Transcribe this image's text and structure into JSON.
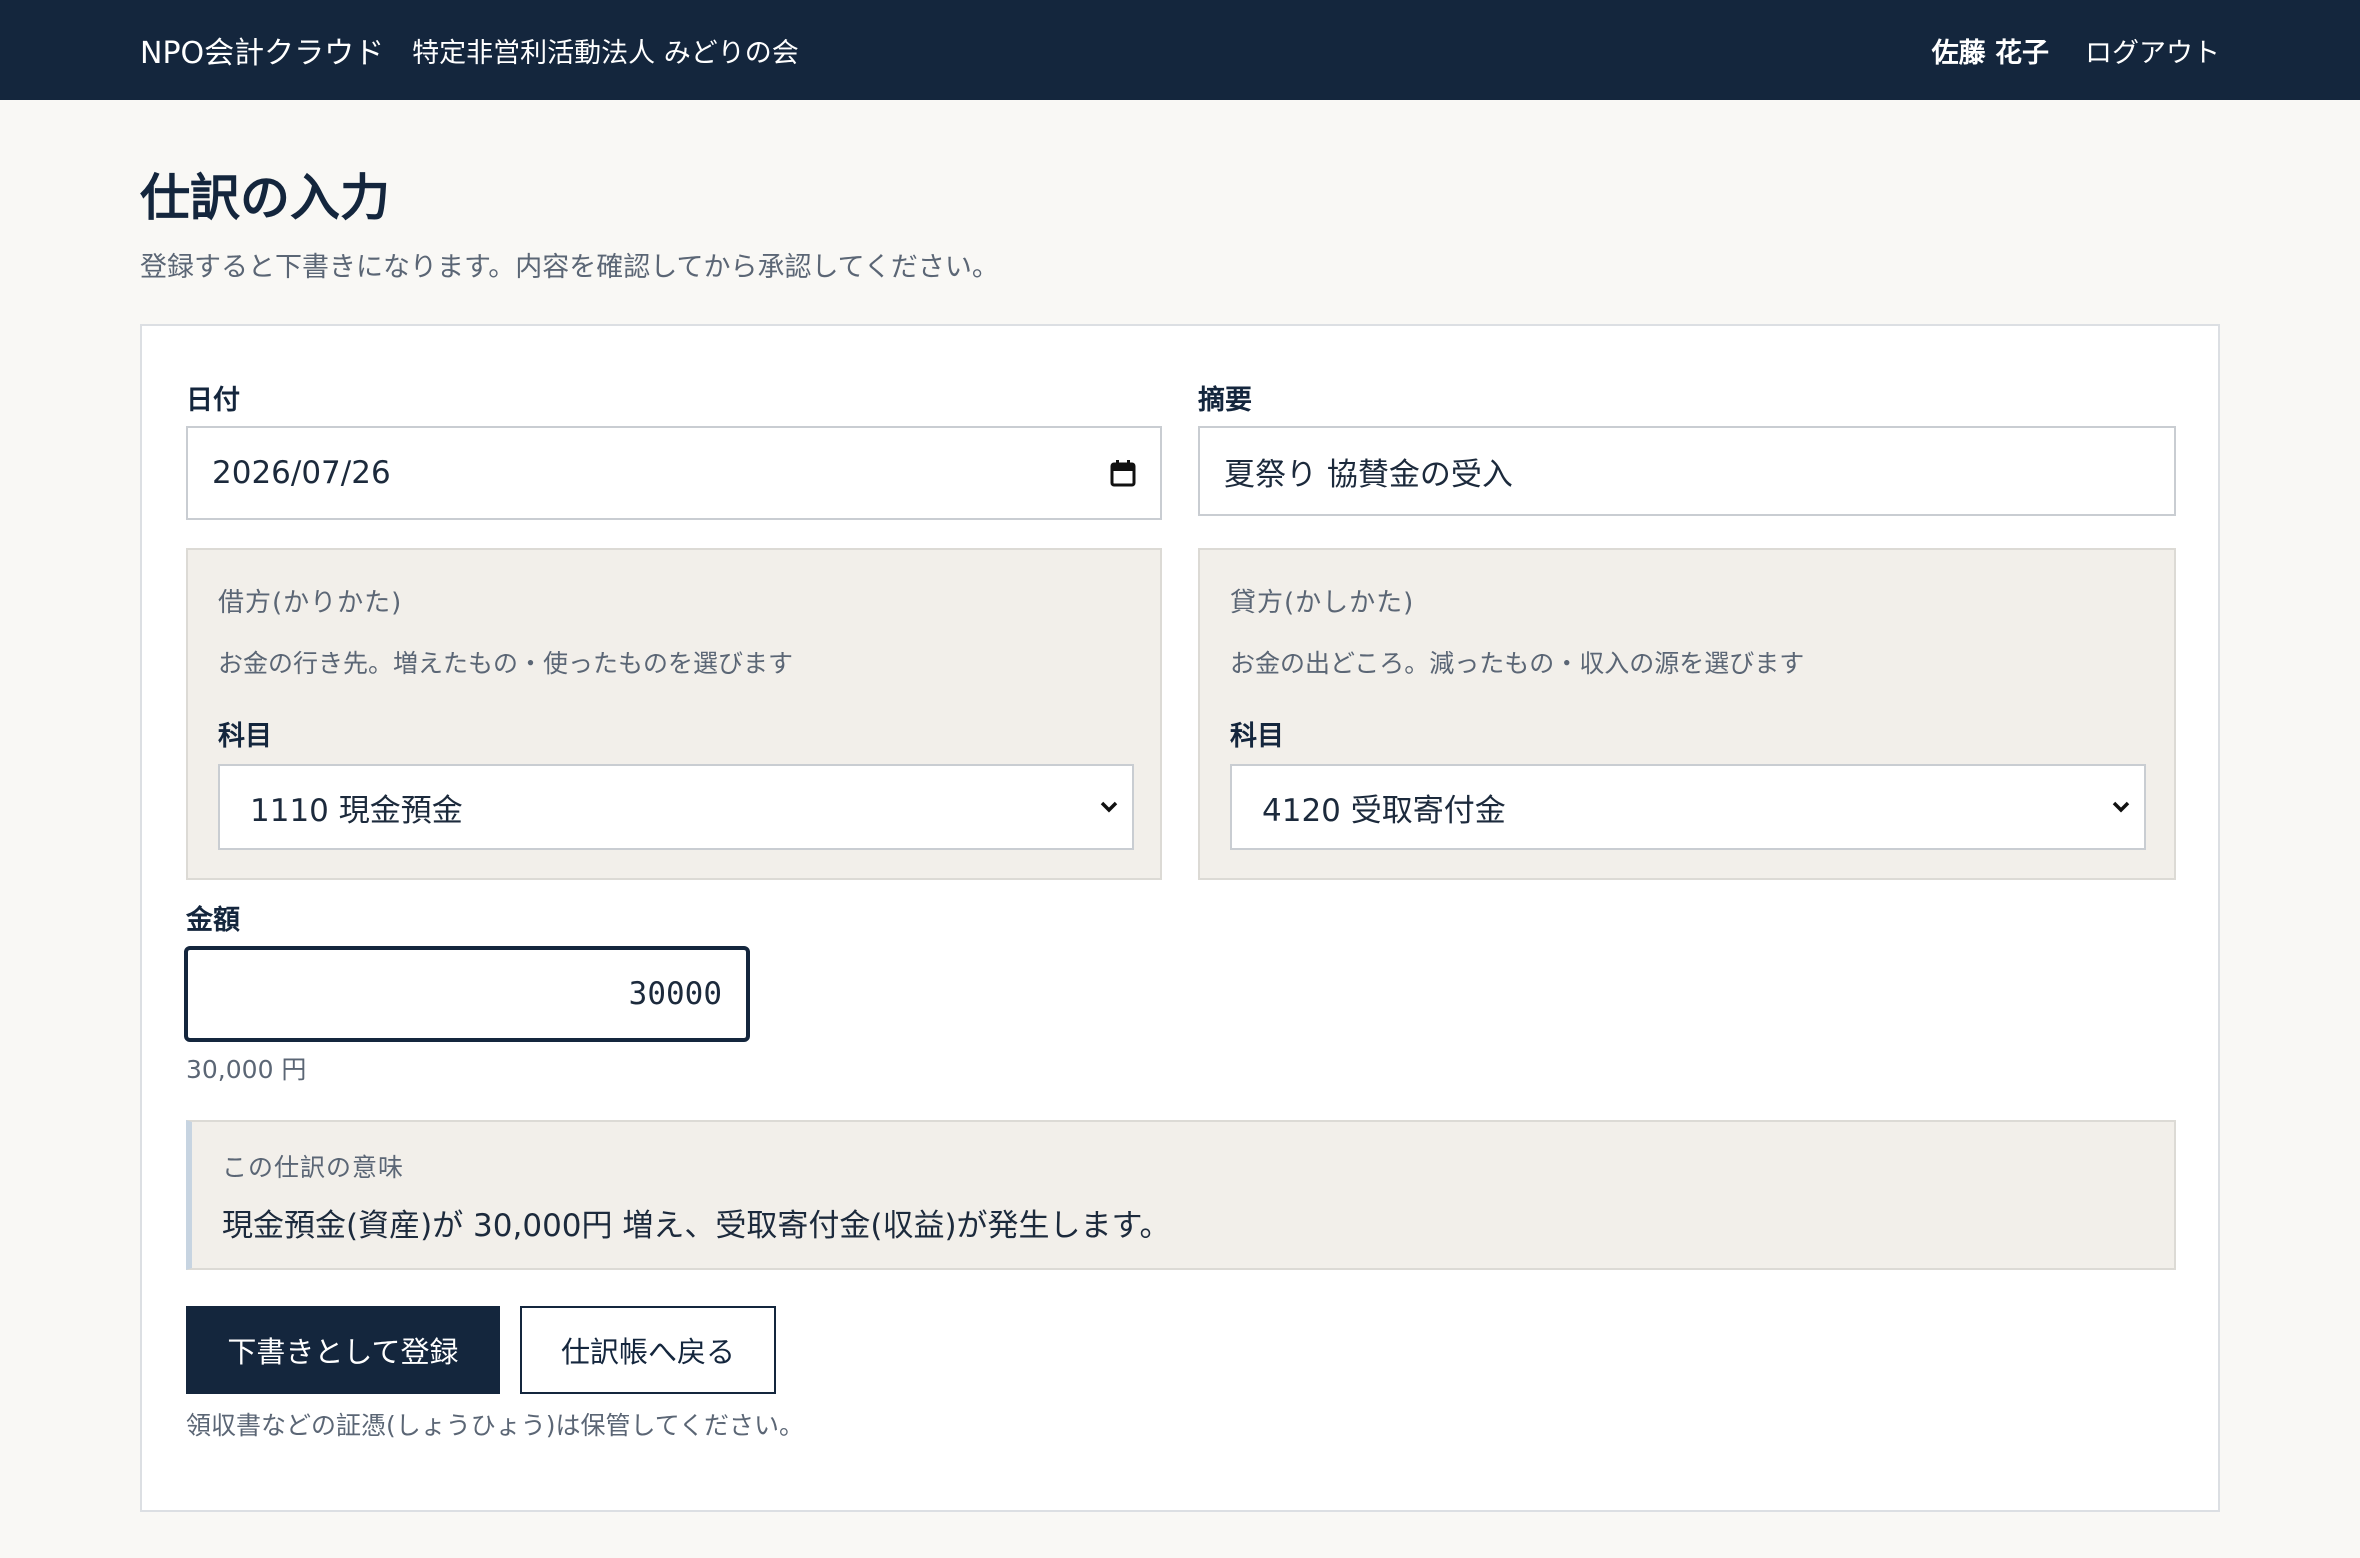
{
  "header": {
    "app_name": "NPO会計クラウド",
    "org_name": "特定非営利活動法人 みどりの会",
    "user_name": "佐藤 花子",
    "logout_label": "ログアウト"
  },
  "page": {
    "title": "仕訳の入力",
    "description": "登録すると下書きになります。内容を確認してから承認してください。"
  },
  "form": {
    "date": {
      "label": "日付",
      "value": "2026/07/26",
      "icon": "calendar-icon"
    },
    "summary": {
      "label": "摘要",
      "value": "夏祭り 協賛金の受入"
    },
    "debit": {
      "title": "借方(かりかた)",
      "help": "お金の行き先。増えたもの・使ったものを選びます",
      "account_label": "科目",
      "account_value": "1110 現金預金"
    },
    "credit": {
      "title": "貸方(かしかた)",
      "help": "お金の出どころ。減ったもの・収入の源を選びます",
      "account_label": "科目",
      "account_value": "4120 受取寄付金"
    },
    "amount": {
      "label": "金額",
      "value": "30000",
      "formatted": "30,000 円"
    },
    "meaning": {
      "title": "この仕訳の意味",
      "text": "現金預金(資産)が 30,000円 増え、受取寄付金(収益)が発生します。"
    },
    "submit_label": "下書きとして登録",
    "back_label": "仕訳帳へ戻る",
    "footnote": "領収書などの証憑(しょうひょう)は保管してください。"
  },
  "colors": {
    "header_bg": "#14263d",
    "page_bg": "#f9f8f5",
    "panel_bg": "#f2efea",
    "primary": "#14263d"
  }
}
